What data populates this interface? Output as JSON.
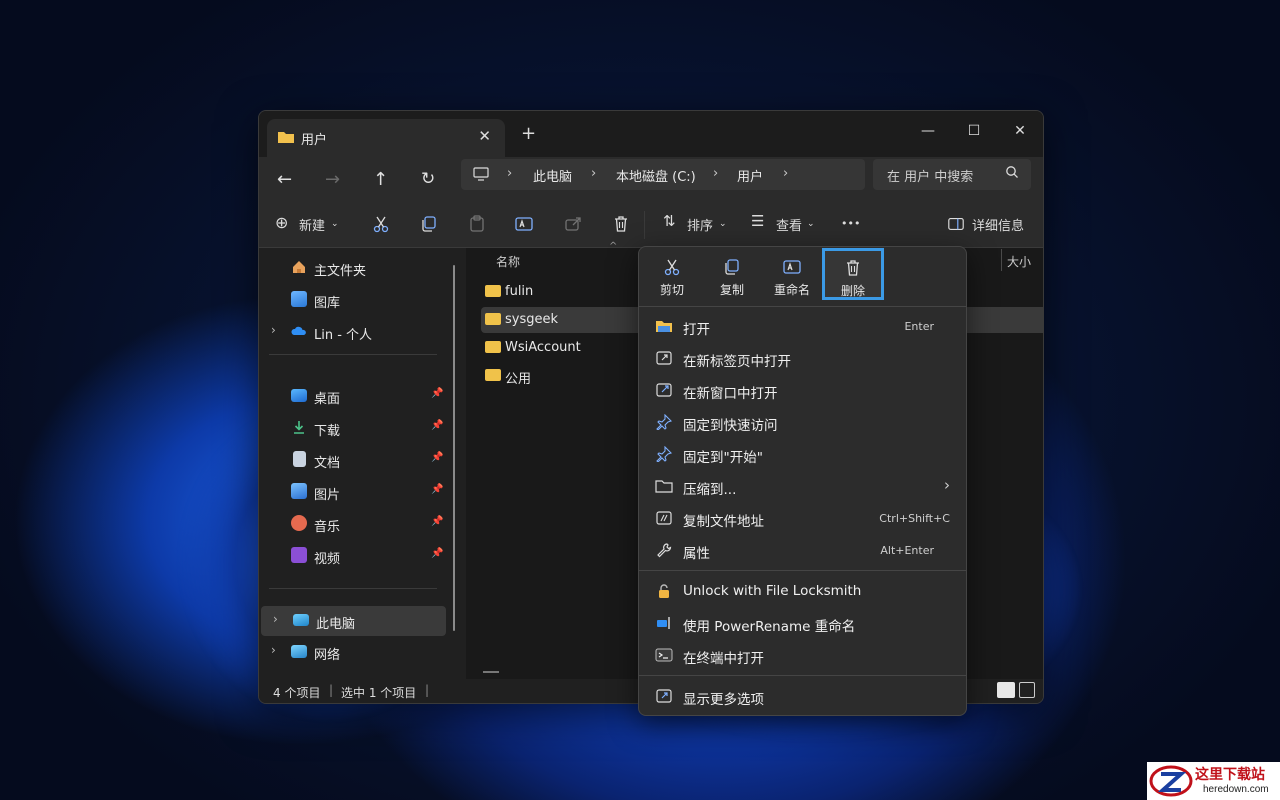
{
  "window": {
    "tab_title": "用户",
    "tab_close": "✕",
    "new_tab": "+",
    "minimize": "—",
    "maximize": "☐",
    "close": "✕"
  },
  "nav": {
    "breadcrumb": [
      "此电脑",
      "本地磁盘 (C:)",
      "用户"
    ],
    "search_placeholder": "在 用户 中搜索"
  },
  "toolbar": {
    "new_label": "新建",
    "sort_label": "排序",
    "view_label": "查看",
    "more_label": "•••",
    "details_label": "详细信息"
  },
  "sidebar": {
    "top": [
      {
        "label": "主文件夹",
        "icon": "home-icon"
      },
      {
        "label": "图库",
        "icon": "gallery-icon"
      },
      {
        "label": "Lin - 个人",
        "icon": "onedrive-icon"
      }
    ],
    "quick": [
      {
        "label": "桌面",
        "icon": "desktop-icon"
      },
      {
        "label": "下载",
        "icon": "download-icon"
      },
      {
        "label": "文档",
        "icon": "documents-icon"
      },
      {
        "label": "图片",
        "icon": "pictures-icon"
      },
      {
        "label": "音乐",
        "icon": "music-icon"
      },
      {
        "label": "视频",
        "icon": "videos-icon"
      }
    ],
    "bottom": [
      {
        "label": "此电脑",
        "icon": "pc-icon"
      },
      {
        "label": "网络",
        "icon": "network-icon"
      }
    ]
  },
  "files": {
    "column_name": "名称",
    "column_size": "大小",
    "items": [
      "fulin",
      "sysgeek",
      "WsiAccount",
      "公用"
    ]
  },
  "status": {
    "count": "4 个项目",
    "selected": "选中 1 个项目"
  },
  "context_menu": {
    "quick_actions": [
      "剪切",
      "复制",
      "重命名",
      "删除"
    ],
    "items": [
      {
        "label": "打开",
        "shortcut": "Enter",
        "icon": "open-folder-icon"
      },
      {
        "label": "在新标签页中打开",
        "shortcut": "",
        "icon": "new-tab-icon"
      },
      {
        "label": "在新窗口中打开",
        "shortcut": "",
        "icon": "new-window-icon"
      },
      {
        "label": "固定到快速访问",
        "shortcut": "",
        "icon": "pin-icon"
      },
      {
        "label": "固定到\"开始\"",
        "shortcut": "",
        "icon": "pin-start-icon"
      },
      {
        "label": "压缩到...",
        "shortcut": "",
        "icon": "zip-icon"
      },
      {
        "label": "复制文件地址",
        "shortcut": "Ctrl+Shift+C",
        "icon": "copy-path-icon"
      },
      {
        "label": "属性",
        "shortcut": "Alt+Enter",
        "icon": "wrench-icon"
      },
      {
        "label": "Unlock with File Locksmith",
        "shortcut": "",
        "icon": "lock-icon"
      },
      {
        "label": "使用 PowerRename 重命名",
        "shortcut": "",
        "icon": "powerrename-icon"
      },
      {
        "label": "在终端中打开",
        "shortcut": "",
        "icon": "terminal-icon"
      },
      {
        "label": "显示更多选项",
        "shortcut": "",
        "icon": "more-options-icon"
      }
    ]
  },
  "watermark": {
    "title": "这里下载站",
    "site": "heredown.com"
  }
}
